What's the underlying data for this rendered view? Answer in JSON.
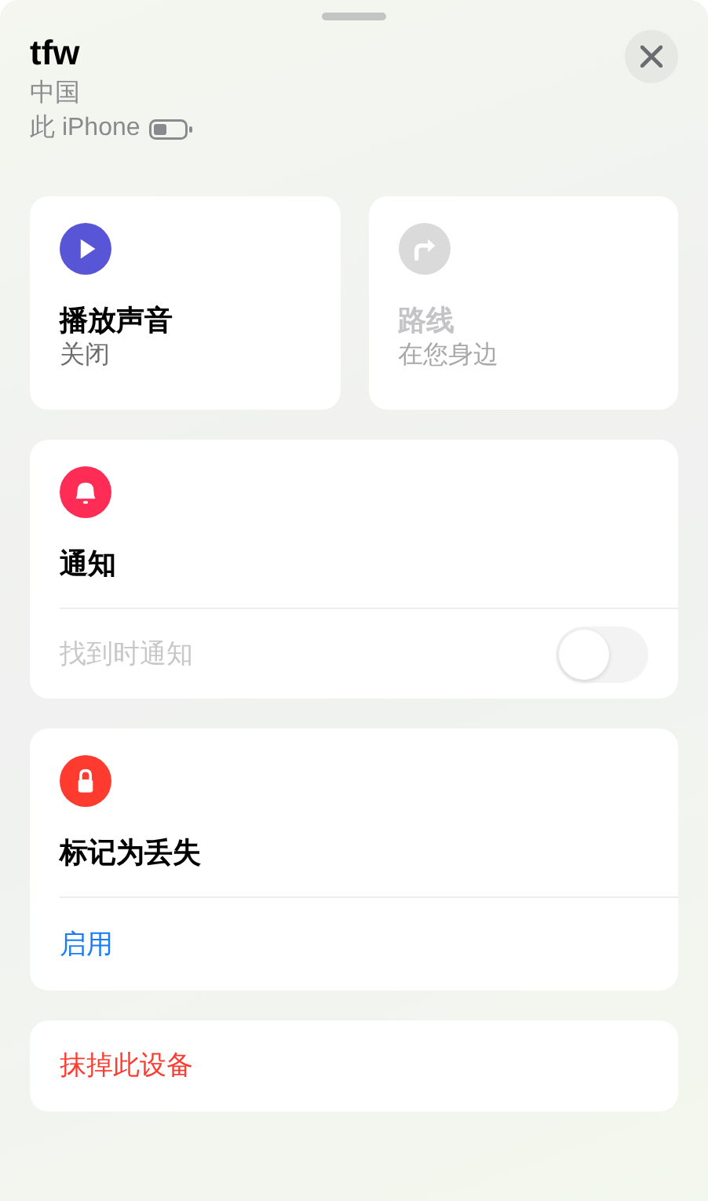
{
  "header": {
    "title": "tfw",
    "location": "中国",
    "device": "此 iPhone"
  },
  "actions": [
    {
      "kind": "sound",
      "title": "播放声音",
      "subtitle": "关闭",
      "disabled": false
    },
    {
      "kind": "directions",
      "title": "路线",
      "subtitle": "在您身边",
      "disabled": true
    }
  ],
  "notifications": {
    "title": "通知",
    "toggle": {
      "label": "找到时通知",
      "on": false,
      "disabled": true
    }
  },
  "lost_mode": {
    "title": "标记为丢失",
    "link": "启用"
  },
  "erase": {
    "label": "抹掉此设备"
  }
}
